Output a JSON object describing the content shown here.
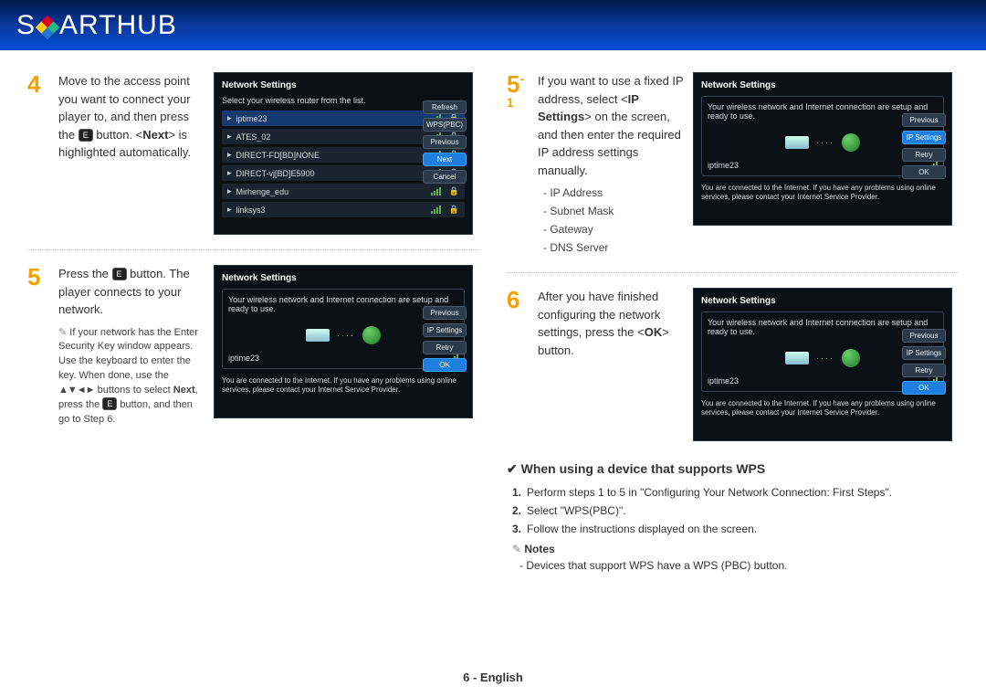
{
  "banner": {
    "text_a": "S",
    "text_b": "ART",
    "text_c": " HUB"
  },
  "footer": "6 - English",
  "enter_btn": "E",
  "shot_title": "Network Settings",
  "s4": {
    "num": "4",
    "text": "Move to the access point you want to connect your player to, and then press the [E] button. <Next> is highlighted automatically.",
    "list_prompt": "Select your wireless router from the list.",
    "networks": [
      "iptime23",
      "ATES_02",
      "DIRECT-FD[BD]NONE",
      "DIRECT-vj[BD]E5900",
      "Mirhenge_edu",
      "linksys3"
    ],
    "buttons": [
      "Refresh",
      "WPS(PBC)",
      "Previous",
      "Next",
      "Cancel"
    ]
  },
  "s5": {
    "num": "5",
    "text": "Press the [E] button. The player connects to your network.",
    "note": "If your network has the Enter Security Key window appears. Use the keyboard to enter the key. When done, use the ▲▼◄► buttons to select Next, press the [E] button, and then go to Step 6.",
    "conn_prompt": "Your wireless network and Internet connection are setup and ready to use.",
    "conn_name": "iptime23",
    "conn_msg": "You are connected to the Internet. If you have any problems using online services, please contact your Internet Service Provider.",
    "buttons": [
      "Previous",
      "IP Settings",
      "Retry",
      "OK"
    ]
  },
  "s51": {
    "num": "5",
    "text": "If you want to use a fixed IP address, select <IP Settings> on the screen, and then enter the required IP address settings manually.",
    "bullets": [
      "IP Address",
      "Subnet Mask",
      "Gateway",
      "DNS Server"
    ],
    "buttons": [
      "Previous",
      "IP Settings",
      "Retry",
      "OK"
    ]
  },
  "s6": {
    "num": "6",
    "text": "After you have finished configuring the network settings, press the <OK> button.",
    "buttons": [
      "Previous",
      "IP Settings",
      "Retry",
      "OK"
    ]
  },
  "wps": {
    "title": "When using a device that supports WPS",
    "steps": [
      "Perform steps 1 to 5 in \"Configuring Your Network Connection: First Steps\".",
      "Select \"WPS(PBC)\".",
      "Follow the instructions displayed on the screen."
    ],
    "notes_label": "Notes",
    "note": "Devices that support WPS have a WPS (PBC) button."
  }
}
